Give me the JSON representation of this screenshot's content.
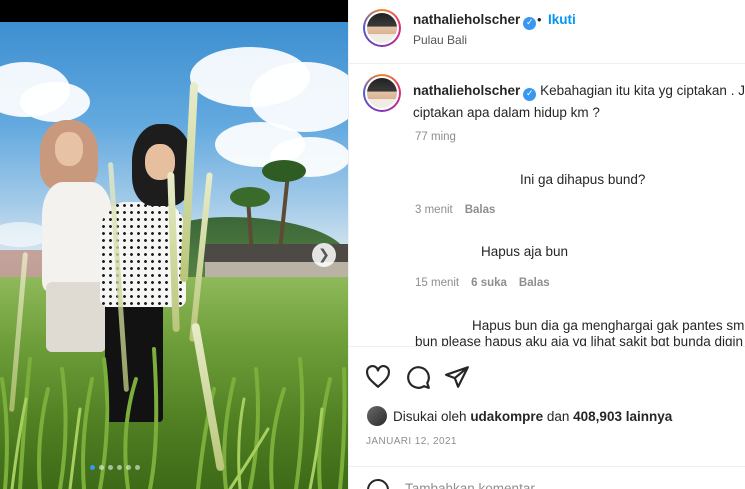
{
  "post": {
    "username": "nathalieholscher",
    "verified": true,
    "follow_label": "Ikuti",
    "location": "Pulau Bali",
    "separator": "•"
  },
  "caption": {
    "username": "nathalieholscher",
    "line1": "Kebahagian itu kita yg ciptakan . Jo",
    "line2": "ciptakan apa dalam hidup km ?",
    "time": "77 ming"
  },
  "comments": [
    {
      "text": "Ini ga dihapus bund?",
      "time": "3 menit",
      "likes": "",
      "reply": "Balas"
    },
    {
      "text": "Hapus aja bun",
      "time": "15 menit",
      "likes": "6 suka",
      "reply": "Balas"
    },
    {
      "text_line1": "Hapus bun dia ga menghargai gak pantes sm",
      "text_line2": "bun please hapus aku aja yg lihat sakit bgt bunda digin"
    }
  ],
  "actions": {
    "icons": [
      "heart-icon",
      "comment-icon",
      "share-icon"
    ]
  },
  "likes": {
    "prefix": "Disukai oleh",
    "user": "udakompre",
    "middle": "dan",
    "count": "408,903",
    "suffix": "lainnya"
  },
  "date": "JANUARI 12, 2021",
  "add_comment": {
    "placeholder": "Tambahkan komentar..."
  },
  "carousel": {
    "total": 6,
    "active": 1
  },
  "colors": {
    "accent": "#0095f6",
    "verified": "#3897f0",
    "meta": "#8e8e8e",
    "text": "#262626"
  }
}
